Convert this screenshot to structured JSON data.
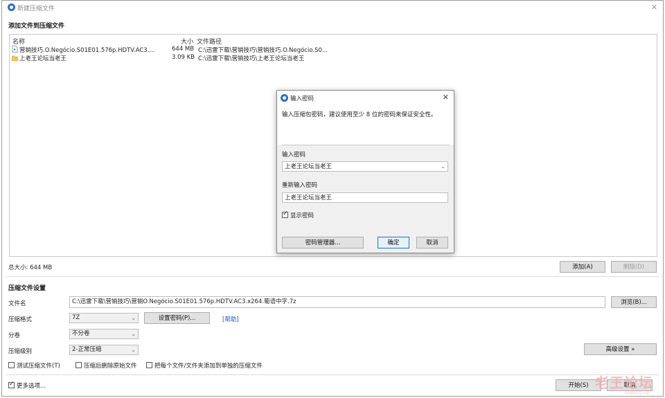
{
  "window": {
    "title": "新建压缩文件"
  },
  "files_section": {
    "title": "添加文件到压缩文件"
  },
  "file_list": {
    "columns": [
      "名称",
      "大小",
      "文件路径"
    ],
    "rows": [
      {
        "icon": "video-file-icon",
        "name": "营销技巧.O.Negócio.S01E01.576p.HDTV.AC3....",
        "size": "644 MB",
        "path": "C:\\迅雷下载\\营销技巧\\营销技巧.O.Negócio.S0..."
      },
      {
        "icon": "folder-icon",
        "name": "上老王论坛当老王",
        "size": "3.09 KB",
        "path": "C:\\迅雷下载\\营销技巧\\上老王论坛当老王"
      }
    ]
  },
  "total_size": "总大小: 644 MB",
  "buttons": {
    "add": "添加(A)",
    "delete": "删除(D)",
    "browse": "浏览(B)...",
    "set_password": "设置密码(P)...",
    "advanced": "高级设置 »",
    "start": "开始(S)",
    "cancel": "取消"
  },
  "settings": {
    "title": "压缩文件设置",
    "filename_label": "文件名",
    "filename_value": "C:\\迅雷下载\\营销技巧\\营销O.Negócio.S01E01.576p.HDTV.AC3.x264.葡语中字.7z",
    "format_label": "压缩格式",
    "format_value": "7Z",
    "help_link": "[帮助]",
    "split_label": "分卷",
    "split_value": "不分卷",
    "level_label": "压缩级别",
    "level_value": "2-正常压缩"
  },
  "options": {
    "test_archive": "测试压缩文件(T)",
    "delete_after": "压缩后删除原始文件",
    "separate_archives": "把每个文件/文件夹添加到单独的压缩文件",
    "more_options": "更多选项..."
  },
  "password_dialog": {
    "title": "输入密码",
    "description": "输入压缩包密码，建议使用至少 8 位的密码来保证安全性。",
    "password_label": "输入密码",
    "password_value": "上老王论坛当老王",
    "reenter_label": "重新输入密码",
    "reenter_value": "上老王论坛当老王",
    "show_password": "显示密码",
    "manager_button": "密码管理器...",
    "ok_button": "确定",
    "cancel_button": "取消"
  },
  "watermark": {
    "main": "老王论坛",
    "sub": "laowang.vip"
  }
}
